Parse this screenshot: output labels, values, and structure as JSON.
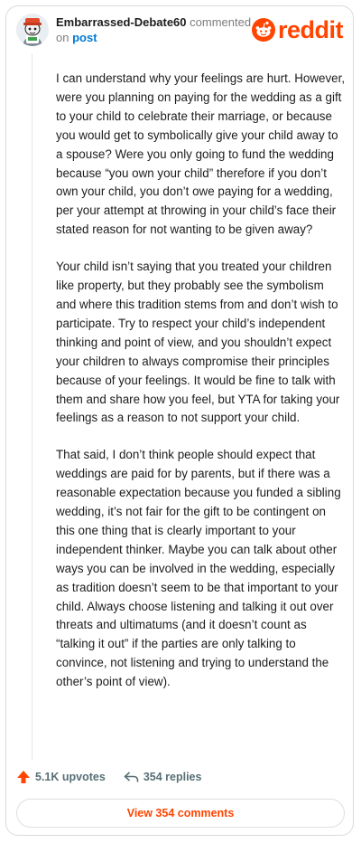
{
  "colors": {
    "brand": "#ff4500",
    "link": "#0079d3",
    "text": "#1c1c1c",
    "muted": "#576f76"
  },
  "header": {
    "username": "Embarrassed-Debate60",
    "action_text": "commented",
    "preposition": "on",
    "post_link": "post",
    "logo_word": "reddit"
  },
  "comment": {
    "paragraphs": [
      "I can understand why your feelings are hurt. However, were you planning on paying for the wedding as a gift to your child to celebrate their marriage, or because you would get to symbolically give your child away to a spouse? Were you only going to fund the wedding because “you own your child” therefore if you don’t own your child, you don’t owe paying for a wedding, per your attempt at throwing in your child’s face their stated reason for not wanting to be given away?",
      "Your child isn’t saying that you treated your children like property, but they probably see the symbolism and where this tradition stems from and don’t wish to participate. Try to respect your child’s independent thinking and point of view, and you shouldn’t expect your children to always compromise their principles because of your feelings. It would be fine to talk with them and share how you feel, but YTA for taking your feelings as a reason to not support your child.",
      "That said, I don’t think people should expect that weddings are paid for by parents, but if there was a reasonable expectation because you funded a sibling wedding, it’s not fair for the gift to be contingent on this one thing that is clearly important to your independent thinker. Maybe you can talk about other ways you can be involved in the wedding, especially as tradition doesn’t seem to be that important to your child. Always choose listening and talking it out over threats and ultimatums (and it doesn’t count as “talking it out” if the parties are only talking to convince, not listening and trying to understand the other’s point of view)."
    ]
  },
  "actions": {
    "upvotes": "5.1K upvotes",
    "replies": "354 replies"
  },
  "view_comments_label": "View 354 comments"
}
